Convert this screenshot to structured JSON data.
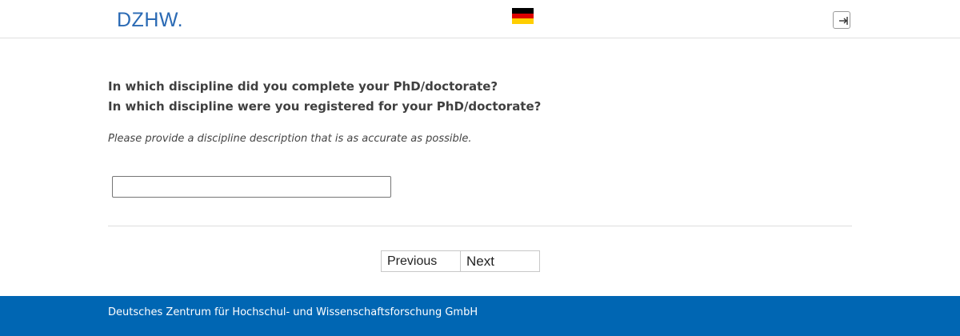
{
  "header": {
    "logo_text": "DZHW.",
    "flag_colors": [
      "#000000",
      "#dd0000",
      "#ffce00"
    ],
    "logout_icon": "logout-icon"
  },
  "question": {
    "line1": "In which discipline did you complete your PhD/doctorate?",
    "line2": "In which discipline were you registered for your PhD/doctorate?",
    "instruction": "Please provide a discipline description that is as accurate as possible.",
    "answer_value": ""
  },
  "navigation": {
    "previous_label": "Previous",
    "next_label": "Next"
  },
  "footer": {
    "text": "Deutsches Zentrum für Hochschul- und Wissenschaftsforschung GmbH",
    "color": "#0066b3"
  }
}
